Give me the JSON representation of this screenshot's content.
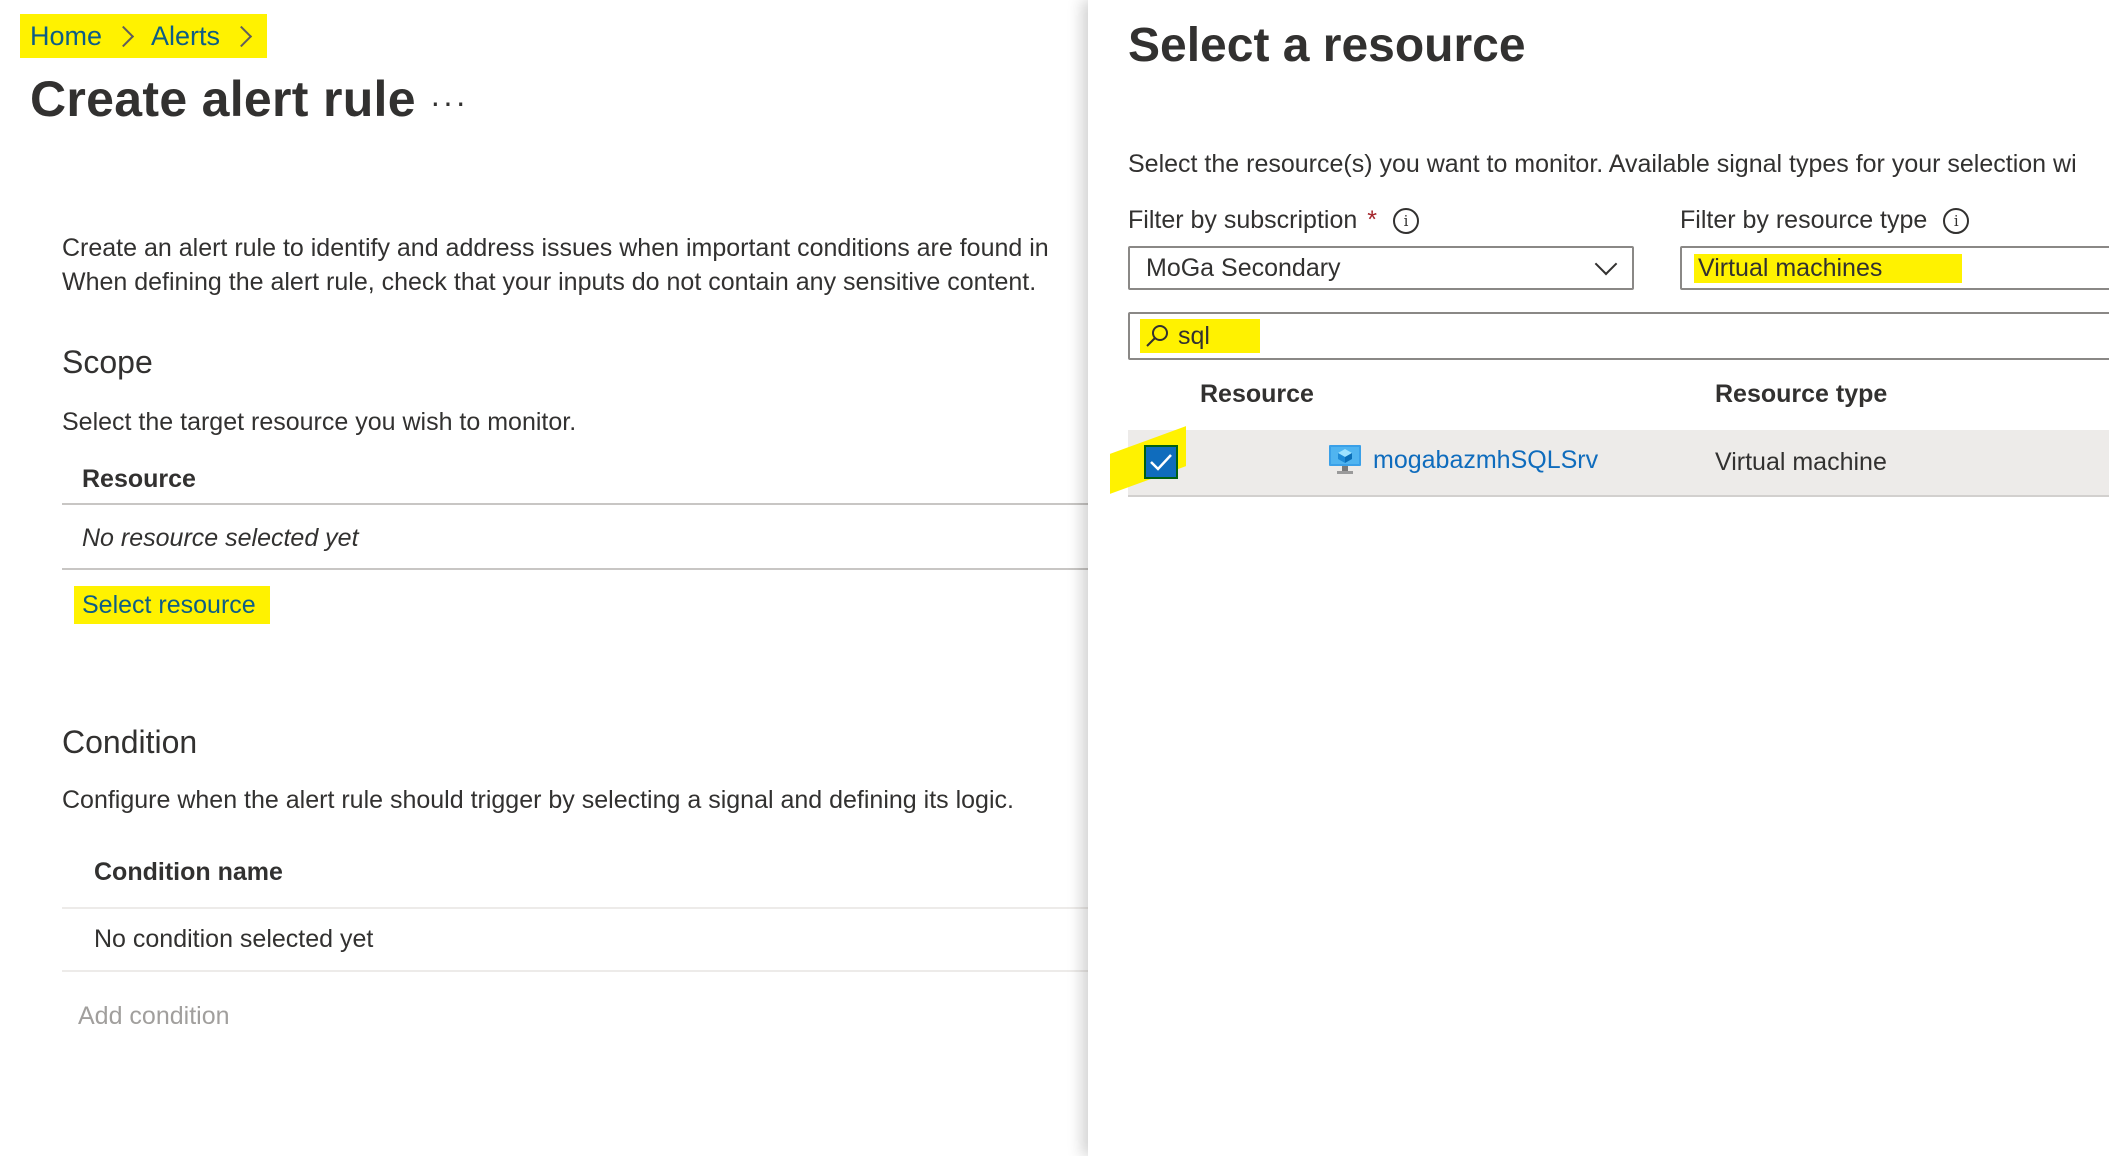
{
  "breadcrumb": {
    "home": "Home",
    "alerts": "Alerts"
  },
  "page": {
    "title": "Create alert rule",
    "more": "···",
    "intro_line1": "Create an alert rule to identify and address issues when important conditions are found in",
    "intro_line2": "When defining the alert rule, check that your inputs do not contain any sensitive content."
  },
  "scope": {
    "heading": "Scope",
    "description": "Select the target resource you wish to monitor.",
    "column_header": "Resource",
    "empty_text": "No resource selected yet",
    "select_link": "Select resource"
  },
  "condition": {
    "heading": "Condition",
    "description": "Configure when the alert rule should trigger by selecting a signal and defining its logic.",
    "column_header": "Condition name",
    "empty_text": "No condition selected yet",
    "add_link": "Add condition"
  },
  "panel": {
    "title": "Select a resource",
    "description": "Select the resource(s) you want to monitor. Available signal types for your selection wi",
    "subscription_label": "Filter by subscription",
    "required_mark": "*",
    "info_glyph": "i",
    "subscription_value": "MoGa Secondary",
    "resource_type_label": "Filter by resource type",
    "resource_type_value": "Virtual machines",
    "search_value": "sql",
    "table": {
      "headers": {
        "resource": "Resource",
        "type": "Resource type"
      },
      "rows": [
        {
          "name": "mogabazmhSQLSrv",
          "type": "Virtual machine",
          "checked": true,
          "icon": "virtual-machine-icon"
        }
      ]
    }
  },
  "colors": {
    "highlight": "#fff200",
    "link": "#0f6cbd",
    "breadcrumb_link": "#0d5d86",
    "text": "#323130",
    "disabled": "#a19f9d",
    "required": "#a4262c"
  }
}
